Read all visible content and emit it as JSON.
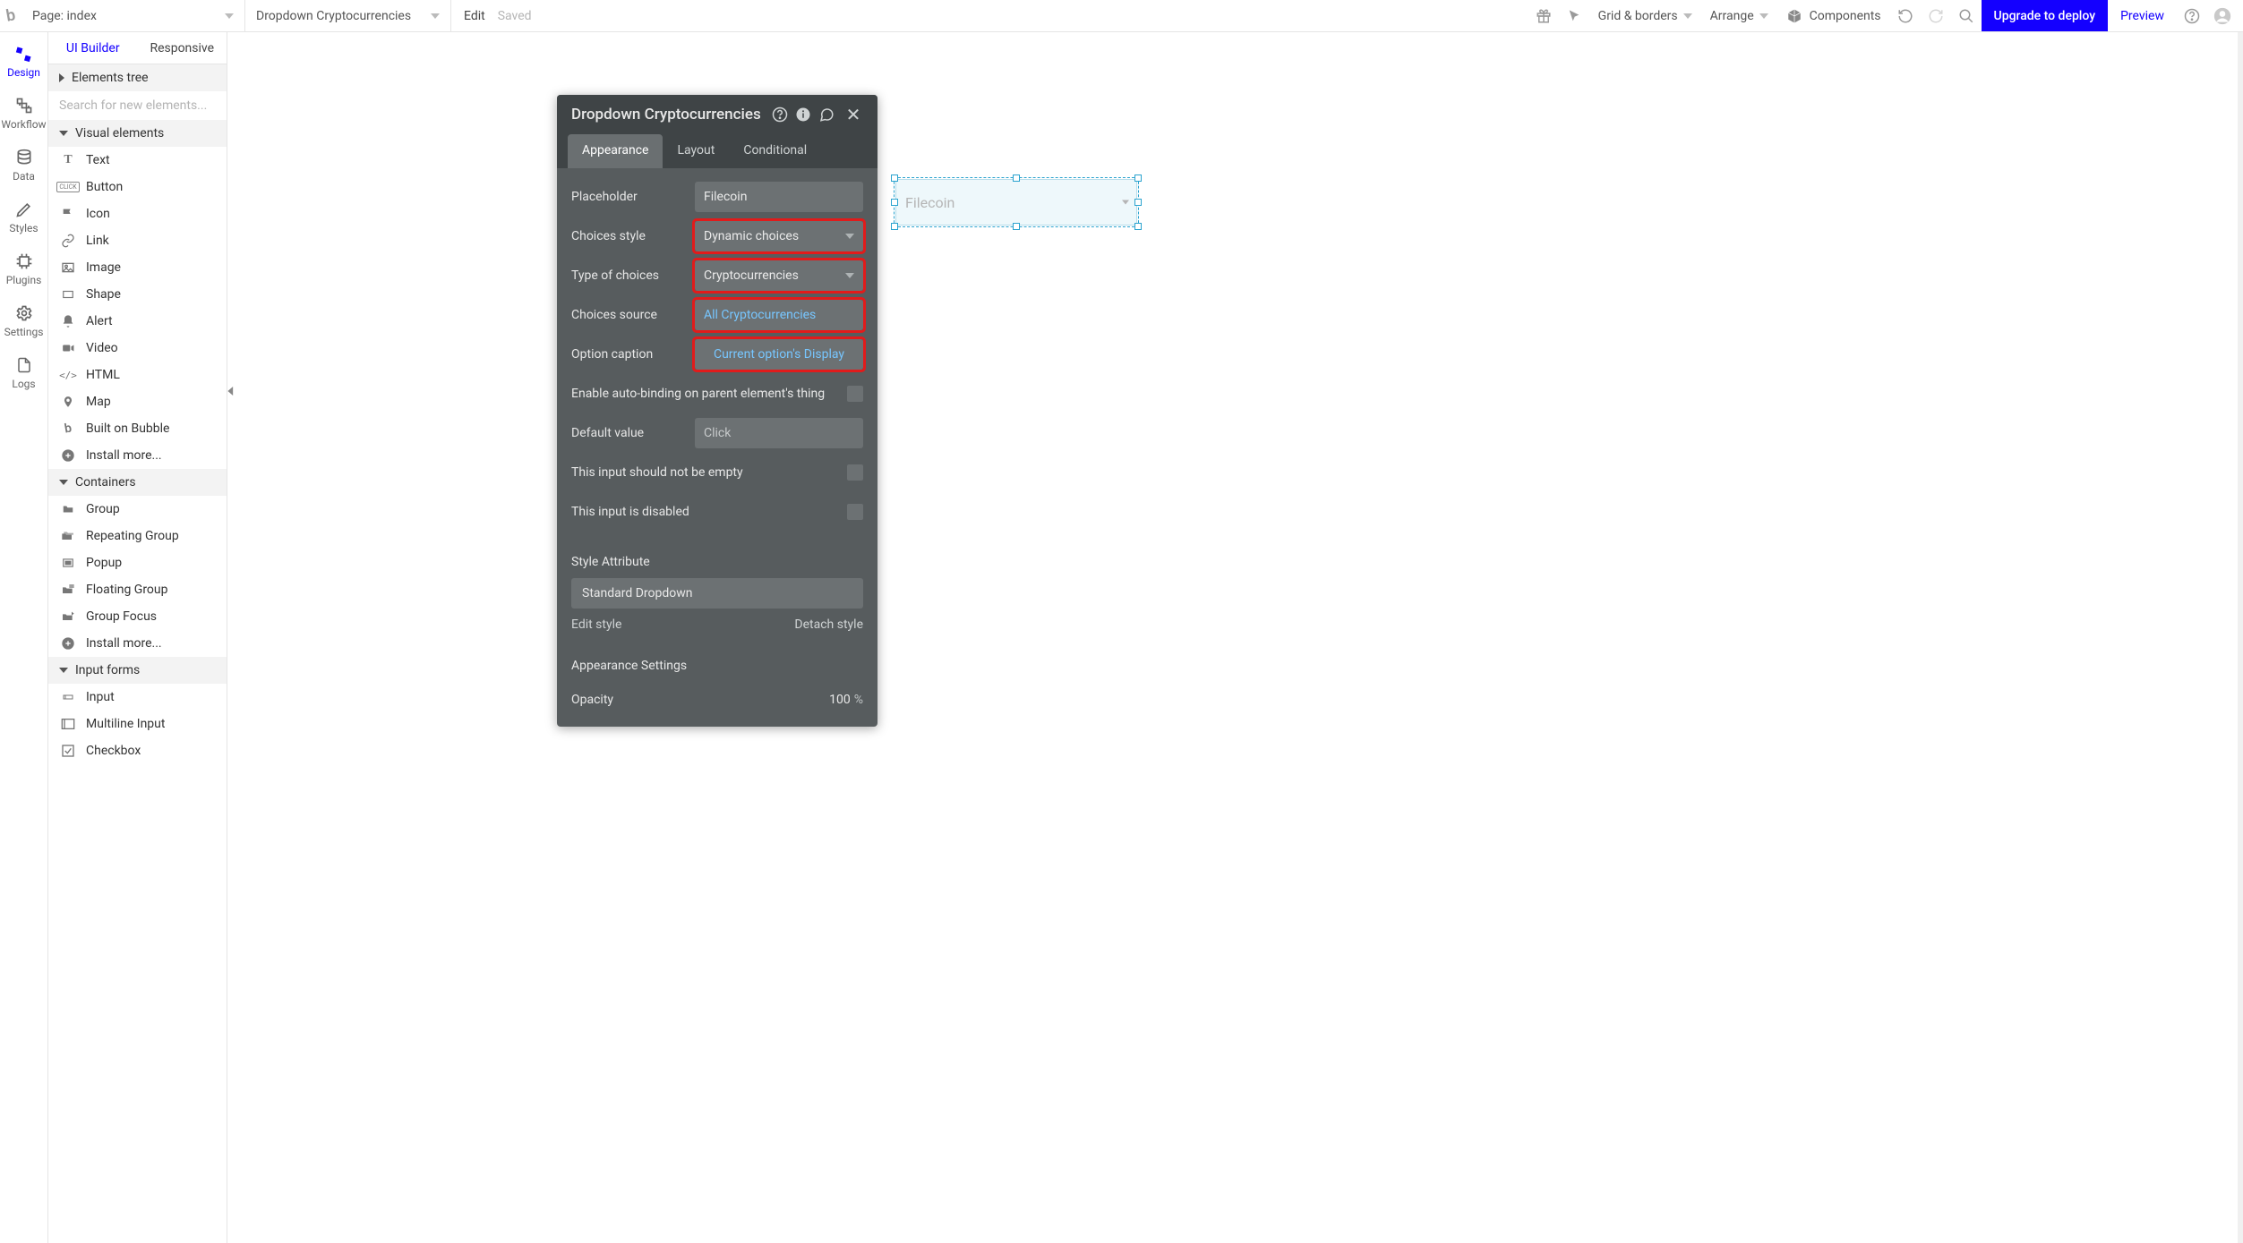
{
  "topbar": {
    "page_label_prefix": "Page: ",
    "page_name": "index",
    "selected_element": "Dropdown Cryptocurrencies",
    "edit": "Edit",
    "saved": "Saved",
    "grid_borders": "Grid & borders",
    "arrange": "Arrange",
    "components": "Components",
    "upgrade": "Upgrade to deploy",
    "preview": "Preview"
  },
  "leftnav": {
    "design": "Design",
    "workflow": "Workflow",
    "data": "Data",
    "styles": "Styles",
    "plugins": "Plugins",
    "settings": "Settings",
    "logs": "Logs"
  },
  "panel": {
    "tab_ui": "UI Builder",
    "tab_responsive": "Responsive",
    "elements_tree": "Elements tree",
    "search_ph": "Search for new elements...",
    "visual_elements": "Visual elements",
    "visual_items": [
      "Text",
      "Button",
      "Icon",
      "Link",
      "Image",
      "Shape",
      "Alert",
      "Video",
      "HTML",
      "Map",
      "Built on Bubble",
      "Install more..."
    ],
    "containers": "Containers",
    "container_items": [
      "Group",
      "Repeating Group",
      "Popup",
      "Floating Group",
      "Group Focus",
      "Install more..."
    ],
    "input_forms": "Input forms",
    "input_items": [
      "Input",
      "Multiline Input",
      "Checkbox"
    ]
  },
  "editor": {
    "title": "Dropdown Cryptocurrencies",
    "tab_appearance": "Appearance",
    "tab_layout": "Layout",
    "tab_conditional": "Conditional",
    "placeholder_label": "Placeholder",
    "placeholder_value": "Filecoin",
    "choices_style_label": "Choices style",
    "choices_style_value": "Dynamic choices",
    "type_choices_label": "Type of choices",
    "type_choices_value": "Cryptocurrencies",
    "choices_source_label": "Choices source",
    "choices_source_value": "All Cryptocurrencies",
    "option_caption_label": "Option caption",
    "option_caption_value": "Current option's Display",
    "autobind_label": "Enable auto-binding on parent element's thing",
    "default_value_label": "Default value",
    "default_value_ph": "Click",
    "not_empty_label": "This input should not be empty",
    "disabled_label": "This input is disabled",
    "style_attribute": "Style Attribute",
    "style_value": "Standard Dropdown",
    "edit_style": "Edit style",
    "detach_style": "Detach style",
    "appearance_settings": "Appearance Settings",
    "opacity_label": "Opacity",
    "opacity_value": "100",
    "opacity_unit": "%"
  },
  "canvas": {
    "dropdown_placeholder": "Filecoin"
  }
}
